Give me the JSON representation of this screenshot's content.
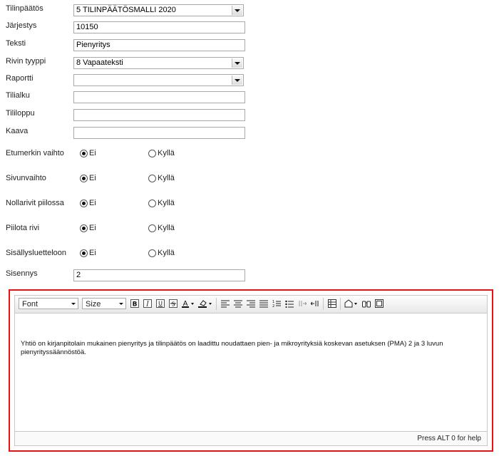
{
  "form": {
    "tilinpaatos": {
      "label": "Tilinpäätös",
      "value": "5 TILINPÄÄTÖSMALLI 2020"
    },
    "jarjestys": {
      "label": "Järjestys",
      "value": "10150"
    },
    "teksti": {
      "label": "Teksti",
      "value": "Pienyritys"
    },
    "rivin_tyyppi": {
      "label": "Rivin tyyppi",
      "value": "8 Vapaateksti"
    },
    "raportti": {
      "label": "Raportti",
      "value": ""
    },
    "tilialku": {
      "label": "Tilialku",
      "value": ""
    },
    "tililoppu": {
      "label": "Tililoppu",
      "value": ""
    },
    "kaava": {
      "label": "Kaava",
      "value": ""
    },
    "radios": [
      {
        "label": "Etumerkin vaihto",
        "no": "Ei",
        "yes": "Kyllä",
        "selected": "no"
      },
      {
        "label": "Sivunvaihto",
        "no": "Ei",
        "yes": "Kyllä",
        "selected": "no"
      },
      {
        "label": "Nollarivit piilossa",
        "no": "Ei",
        "yes": "Kyllä",
        "selected": "no"
      },
      {
        "label": "Piilota rivi",
        "no": "Ei",
        "yes": "Kyllä",
        "selected": "no"
      },
      {
        "label": "Sisällysluetteloon",
        "no": "Ei",
        "yes": "Kyllä",
        "selected": "no"
      }
    ],
    "sisennys": {
      "label": "Sisennys",
      "value": "2"
    }
  },
  "editor": {
    "font_select": "Font",
    "size_select": "Size",
    "content": "Yhtiö on kirjanpitolain mukainen pienyritys ja tilinpäätös on laadittu noudattaen pien- ja mikroyrityksiä koskevan asetuksen (PMA) 2 ja 3 luvun pienyrityssäännöstöä.",
    "help_text": "Press ALT 0 for help",
    "highlight_color": "#e11111",
    "toolbar_icons": [
      "bold-icon",
      "italic-icon",
      "underline-icon",
      "strikethrough-icon",
      "text-color-icon",
      "background-color-icon",
      "align-left-icon",
      "align-center-icon",
      "align-right-icon",
      "align-justify-icon",
      "numbered-list-icon",
      "bulleted-list-icon",
      "ltr-icon",
      "rtl-icon",
      "table-icon",
      "insert-dropdown-icon",
      "binoculars-icon",
      "source-icon"
    ]
  }
}
